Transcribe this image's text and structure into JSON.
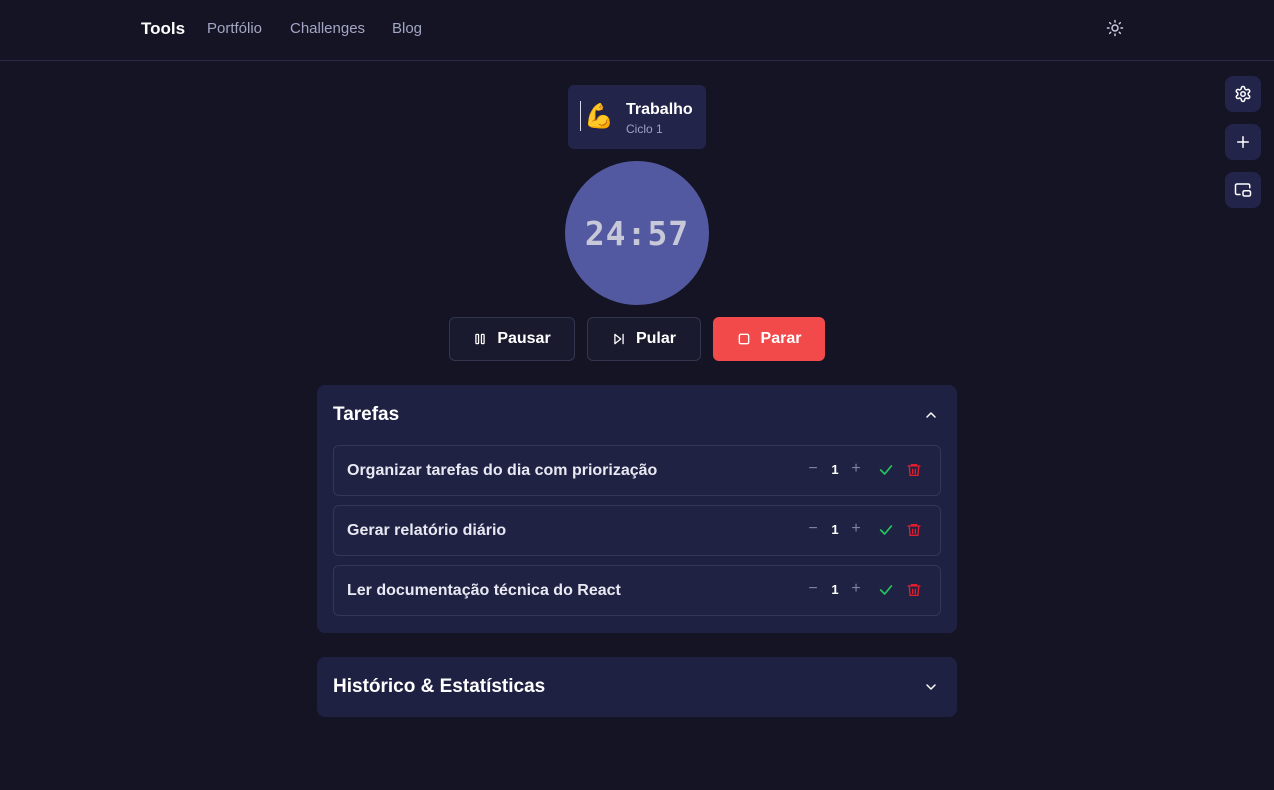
{
  "header": {
    "brand": "Tools",
    "nav": [
      "Portfólio",
      "Challenges",
      "Blog"
    ],
    "theme_icon": "sun-icon"
  },
  "side_actions": [
    {
      "icon": "gear-icon"
    },
    {
      "icon": "plus-icon"
    },
    {
      "icon": "picture-in-picture-icon"
    }
  ],
  "mode": {
    "emoji": "💪",
    "title": "Trabalho",
    "subtitle": "Ciclo 1"
  },
  "timer": {
    "minutes": "24",
    "separator": ":",
    "seconds": "57",
    "color": "#5359a0"
  },
  "controls": {
    "pause_label": "Pausar",
    "skip_label": "Pular",
    "stop_label": "Parar",
    "stop_color": "#f24a4a"
  },
  "tasks_panel": {
    "title": "Tarefas",
    "expanded": true,
    "tasks": [
      {
        "label": "Organizar tarefas do dia com priorização",
        "minus": "−",
        "count": "1",
        "plus": "+"
      },
      {
        "label": "Gerar relatório diário",
        "minus": "−",
        "count": "1",
        "plus": "+"
      },
      {
        "label": "Ler documentação técnica do React",
        "minus": "−",
        "count": "1",
        "plus": "+"
      }
    ]
  },
  "history_panel": {
    "title": "Histórico & Estatísticas",
    "expanded": false
  }
}
